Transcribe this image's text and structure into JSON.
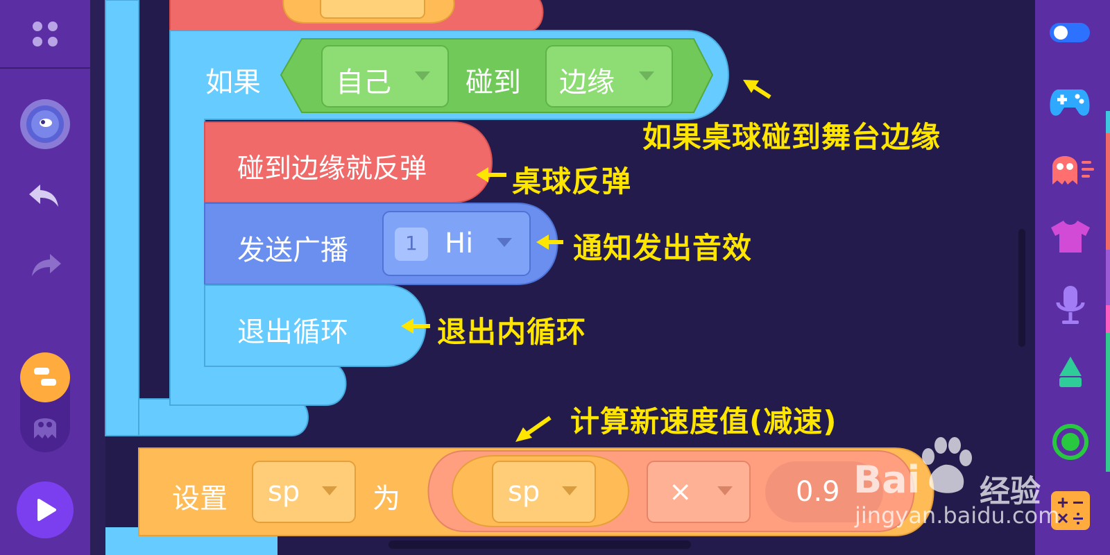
{
  "toolbar_left": {
    "menu_icon": "grid-icon",
    "avatar_icon": "planet-avatar-icon",
    "undo_icon": "undo-icon",
    "redo_icon": "redo-icon",
    "blocks_icon": "blocks-toggle-icon",
    "sprite_icon": "ghost-sprite-icon",
    "play_icon": "play-icon"
  },
  "toolbar_right": {
    "icons": [
      "toggle-icon",
      "gamepad-icon",
      "ghost-icon",
      "shirt-icon",
      "microphone-icon",
      "pen-icon",
      "target-icon",
      "calculator-icon"
    ]
  },
  "blocks": {
    "if_label": "如果",
    "self_dropdown": "自己",
    "touch_label": "碰到",
    "edge_dropdown": "边缘",
    "bounce_label": "碰到边缘就反弹",
    "broadcast_label": "发送广播",
    "broadcast_number": "1",
    "broadcast_value": "Hi",
    "break_label": "退出循环",
    "set_label": "设置",
    "var_dropdown": "sp",
    "to_label": "为",
    "inner_var": "sp",
    "operator": "×",
    "number_value": "0.9"
  },
  "annotations": {
    "if_note": "如果桌球碰到舞台边缘",
    "bounce_note": "桌球反弹",
    "broadcast_note": "通知发出音效",
    "break_note": "退出内循环",
    "set_note": "计算新速度值(减速)"
  },
  "watermark": {
    "brand": "Bai",
    "brand_tail": "经验",
    "url": "jingyan.baidu.com"
  },
  "colors": {
    "stage_bg": "#231b4b",
    "sidebar": "#5b2fa3",
    "control_block": "#66ccff",
    "motion_block": "#f06a6a",
    "sensing_block": "#71c95a",
    "event_block": "#6a8fef",
    "operator_block": "#ffbb55",
    "annotation": "#ffe600"
  }
}
